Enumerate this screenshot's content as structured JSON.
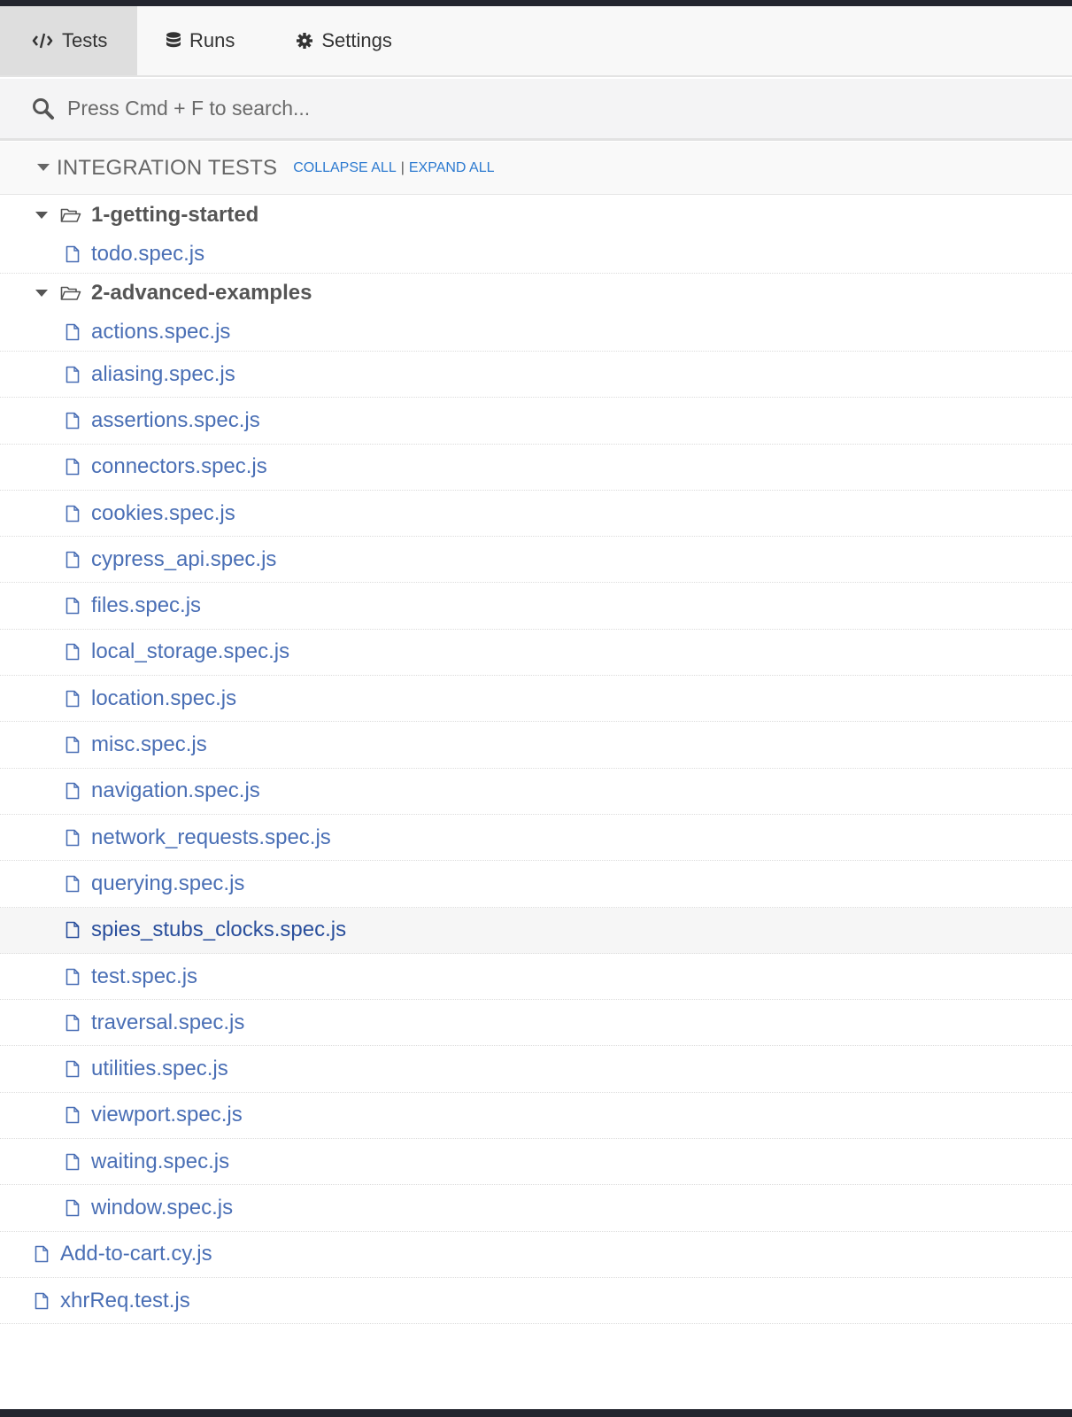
{
  "nav": {
    "tabs": [
      {
        "label": "Tests",
        "icon": "code-icon",
        "active": true
      },
      {
        "label": "Runs",
        "icon": "database-icon",
        "active": false
      },
      {
        "label": "Settings",
        "icon": "gear-icon",
        "active": false
      }
    ]
  },
  "search": {
    "placeholder": "Press Cmd + F to search...",
    "value": ""
  },
  "section": {
    "title": "INTEGRATION TESTS",
    "collapse_label": "COLLAPSE ALL",
    "separator": "|",
    "expand_label": "EXPAND ALL"
  },
  "tree": {
    "folder1": {
      "name": "1-getting-started",
      "files": [
        "todo.spec.js"
      ]
    },
    "folder2": {
      "name": "2-advanced-examples",
      "files": [
        "actions.spec.js",
        "aliasing.spec.js",
        "assertions.spec.js",
        "connectors.spec.js",
        "cookies.spec.js",
        "cypress_api.spec.js",
        "files.spec.js",
        "local_storage.spec.js",
        "location.spec.js",
        "misc.spec.js",
        "navigation.spec.js",
        "network_requests.spec.js",
        "querying.spec.js",
        "spies_stubs_clocks.spec.js",
        "test.spec.js",
        "traversal.spec.js",
        "utilities.spec.js",
        "viewport.spec.js",
        "waiting.spec.js",
        "window.spec.js"
      ],
      "selected": "spies_stubs_clocks.spec.js"
    },
    "root_files": [
      "Add-to-cart.cy.js",
      "xhrReq.test.js"
    ]
  },
  "colors": {
    "link": "#4a6fb5",
    "accent": "#2c7ad0",
    "selected_text": "#2a4f9c"
  }
}
